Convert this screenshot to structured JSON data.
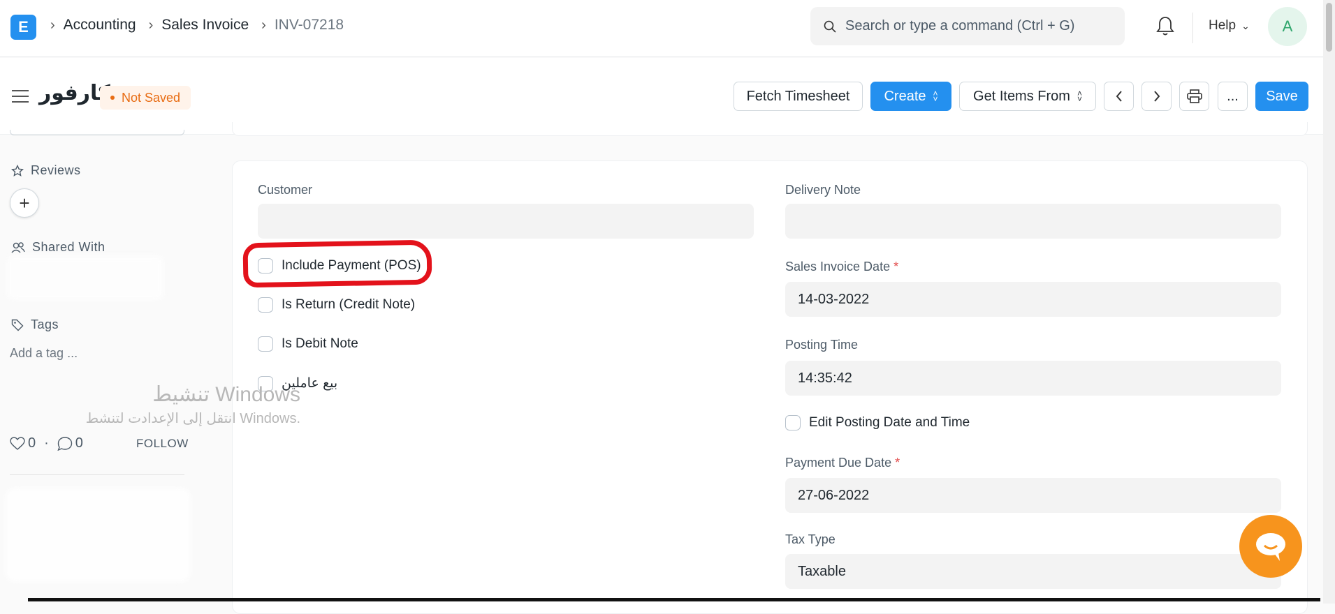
{
  "navbar": {
    "logo_letter": "E",
    "breadcrumbs": [
      "Accounting",
      "Sales Invoice",
      "INV-07218"
    ],
    "search_placeholder": "Search or type a command (Ctrl + G)",
    "help_label": "Help",
    "avatar_initial": "A"
  },
  "page": {
    "title": "كارفور",
    "status": "Not Saved",
    "buttons": {
      "fetch_timesheet": "Fetch Timesheet",
      "create": "Create",
      "get_items_from": "Get Items From",
      "more": "...",
      "save": "Save"
    }
  },
  "sidebar": {
    "reviews_label": "Reviews",
    "shared_with_label": "Shared With",
    "tags_label": "Tags",
    "add_tag": "Add a tag ...",
    "likes": "0",
    "comments": "0",
    "follow": "FOLLOW"
  },
  "form": {
    "customer_label": "Customer",
    "customer_value": "",
    "checks": [
      {
        "label": "Include Payment (POS)",
        "checked": false
      },
      {
        "label": "Is Return (Credit Note)",
        "checked": false
      },
      {
        "label": "Is Debit Note",
        "checked": false
      },
      {
        "label": "بيع عاملين",
        "checked": false
      }
    ],
    "delivery_note_label": "Delivery Note",
    "delivery_note_value": "",
    "invoice_date_label": "Sales Invoice Date",
    "invoice_date_value": "14-03-2022",
    "posting_time_label": "Posting Time",
    "posting_time_value": "14:35:42",
    "edit_posting_label": "Edit Posting Date and Time",
    "due_date_label": "Payment Due Date",
    "due_date_value": "27-06-2022",
    "tax_type_label": "Tax Type",
    "tax_type_value": "Taxable",
    "required_mark": "*"
  },
  "watermark": {
    "line1": "تنشيط Windows",
    "line2": "انتقل إلى الإعدادت لتنشط Windows."
  },
  "colors": {
    "primary": "#2490ef",
    "not_saved": "#e86c13",
    "annotation": "#e3121b",
    "chat": "#f7941d"
  }
}
